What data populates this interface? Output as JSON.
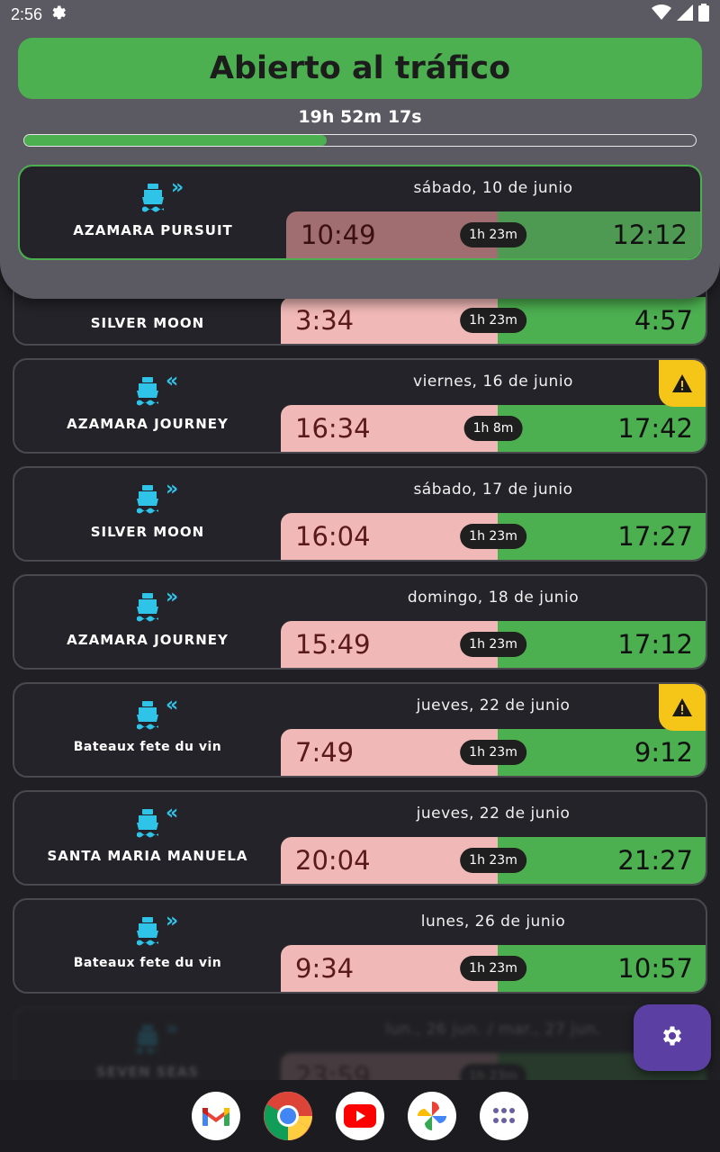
{
  "status_bar": {
    "time": "2:56",
    "icons": [
      "settings-gear-icon",
      "wifi-icon",
      "signal-icon",
      "battery-icon"
    ]
  },
  "header": {
    "status": "Abierto al tráfico",
    "countdown": "19h 52m 17s",
    "progress_fraction": 0.45,
    "colors": {
      "open": "#4caf50",
      "panel": "#5b5a62"
    }
  },
  "featured": {
    "direction": "in",
    "direction_glyph": "»",
    "ship": "AZAMARA PURSUIT",
    "date": "sábado, 10 de junio",
    "close_time": "10:49",
    "duration": "1h 23m",
    "open_time": "12:12"
  },
  "partial": {
    "ship": "SILVER MOON",
    "close_time": "3:34",
    "duration": "1h 23m",
    "open_time": "4:57"
  },
  "openings": [
    {
      "direction": "out",
      "direction_glyph": "«",
      "ship": "AZAMARA JOURNEY",
      "date": "viernes, 16 de junio",
      "close_time": "16:34",
      "duration": "1h 8m",
      "open_time": "17:42",
      "warning": true
    },
    {
      "direction": "in",
      "direction_glyph": "»",
      "ship": "SILVER MOON",
      "date": "sábado, 17 de junio",
      "close_time": "16:04",
      "duration": "1h 23m",
      "open_time": "17:27",
      "warning": false
    },
    {
      "direction": "in",
      "direction_glyph": "»",
      "ship": "AZAMARA JOURNEY",
      "date": "domingo, 18 de junio",
      "close_time": "15:49",
      "duration": "1h 23m",
      "open_time": "17:12",
      "warning": false
    },
    {
      "direction": "out",
      "direction_glyph": "«",
      "ship": "Bateaux fete du vin",
      "date": "jueves, 22 de junio",
      "close_time": "7:49",
      "duration": "1h 23m",
      "open_time": "9:12",
      "warning": true
    },
    {
      "direction": "out",
      "direction_glyph": "«",
      "ship": "SANTA MARIA MANUELA",
      "date": "jueves, 22 de junio",
      "close_time": "20:04",
      "duration": "1h 23m",
      "open_time": "21:27",
      "warning": false
    },
    {
      "direction": "in",
      "direction_glyph": "»",
      "ship": "Bateaux fete du vin",
      "date": "lunes, 26 de junio",
      "close_time": "9:34",
      "duration": "1h 23m",
      "open_time": "10:57",
      "warning": false
    }
  ],
  "faded": {
    "date": "lun., 26 jun. / mar., 27 jun.",
    "ship": "SEVEN SEAS",
    "close_time": "23:59",
    "duration": "1h 23m"
  },
  "fab": {
    "icon": "settings-gear-icon"
  },
  "dock": {
    "apps": [
      "gmail-icon",
      "chrome-icon",
      "youtube-icon",
      "photos-icon",
      "app-drawer-icon"
    ]
  }
}
